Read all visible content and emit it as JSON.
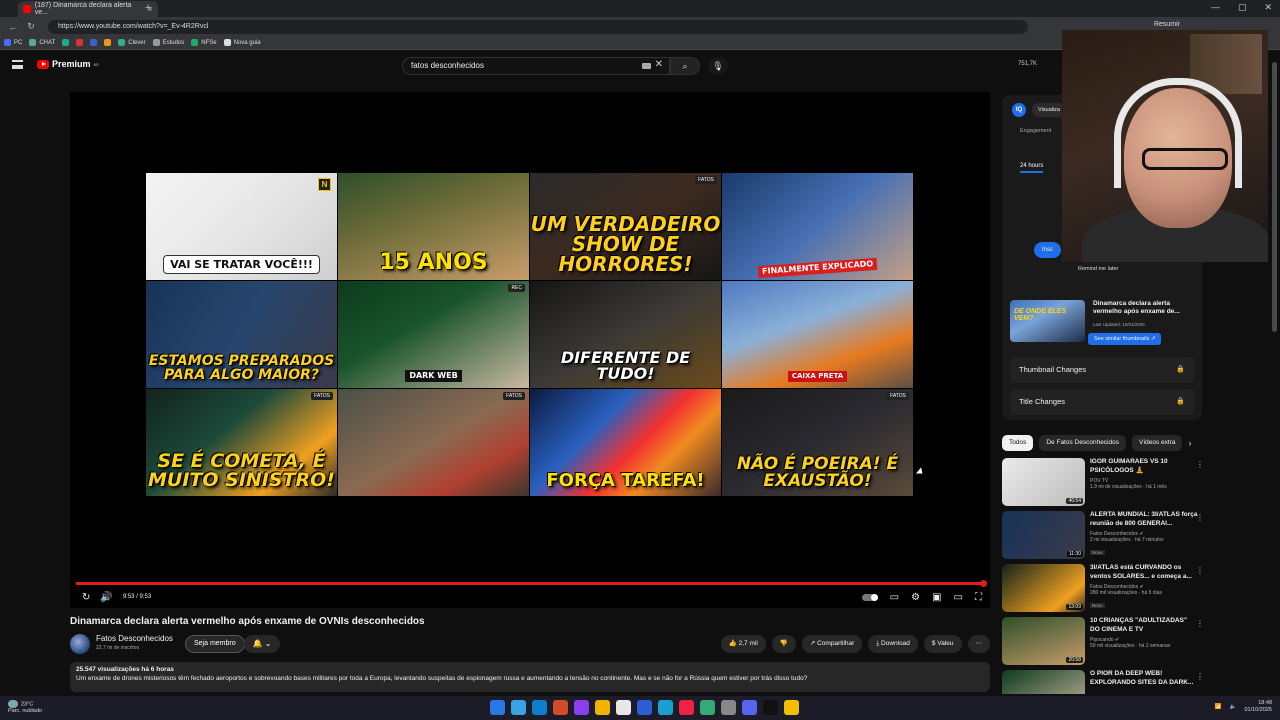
{
  "browser": {
    "tab_title": "(187) Dinamarca declara alerta ve...",
    "tab_close": "×",
    "new_tab": "+",
    "url": "https://www.youtube.com/watch?v=_Ev-4R2Rvcl",
    "resume_label": "Resumir",
    "window_controls": [
      "—",
      "▢",
      "✕"
    ],
    "bookmarks": [
      {
        "label": "PC",
        "color": "#4a6cf7"
      },
      {
        "label": "CHAT",
        "color": "#5a9"
      },
      {
        "label": "",
        "color": "#2a8"
      },
      {
        "label": "",
        "color": "#d33"
      },
      {
        "label": "",
        "color": "#36c"
      },
      {
        "label": "",
        "color": "#e91"
      },
      {
        "label": "Clever",
        "color": "#3a8"
      },
      {
        "label": "Estudos",
        "color": "#999"
      },
      {
        "label": "NFSe",
        "color": "#2a6"
      },
      {
        "label": "Nova guia",
        "color": "#ddd"
      }
    ]
  },
  "youtube": {
    "logo_text": "Premium",
    "logo_sup": "BR",
    "search_value": "fatos desconhecidos",
    "search_clear": "✕",
    "search_icon": "⌕",
    "mic_icon": "🎙",
    "stats_text": "751,7K",
    "colors": {
      "accent": "#e21c1c",
      "brand_blue": "#1f6feb"
    }
  },
  "player": {
    "thumbnails": [
      {
        "caption": "VAI SE TRATAR VOCÊ!!!",
        "badge": "N"
      },
      {
        "caption": "15 ANOS",
        "badge": ""
      },
      {
        "caption": "UM VERDADEIRO SHOW DE HORRORES!",
        "badge": "FATOS"
      },
      {
        "caption": "FINALMENTE EXPLICADO",
        "badge": ""
      },
      {
        "caption": "ESTAMOS PREPARADOS PARA ALGO MAIOR?",
        "badge": ""
      },
      {
        "caption": "DARK WEB",
        "badge": "REC"
      },
      {
        "caption": "DIFERENTE DE TUDO!",
        "badge": ""
      },
      {
        "caption": "CAIXA PRETA",
        "badge": ""
      },
      {
        "caption": "SE É COMETA, É MUITO SINISTRO!",
        "badge": "FATOS"
      },
      {
        "caption": "",
        "badge": "FATOS"
      },
      {
        "caption": "FORÇA TAREFA!",
        "badge": ""
      },
      {
        "caption": "NÃO É POEIRA! É EXAUSTÃO!",
        "badge": "FATOS"
      }
    ],
    "progress_fraction": 1.0,
    "time_display": "9:53 / 9:53",
    "replay_icon": "↻",
    "volume_icon": "🔊",
    "subtitles_icon": "▭",
    "settings_icon": "⚙",
    "miniplayer_icon": "▣",
    "theater_icon": "▭",
    "fullscreen_icon": "⛶"
  },
  "video": {
    "title": "Dinamarca declara alerta vermelho após enxame de OVNIs desconhecidos",
    "channel_name": "Fatos Desconhecidos",
    "subscribers": "22,7 mi de inscritos",
    "join_label": "Seja membro",
    "bell_label": "🔔 ⌄",
    "likes": "👍 2,7 mil",
    "dislike": "👎",
    "share": "↗ Compartilhar",
    "download": "⤓ Download",
    "thanks": "$ Valeu",
    "more": "⋯",
    "views_time": "25.547 visualizações  há 6 horas",
    "description": "Um enxame de drones misteriosos têm fechado aeroportos e sobrevoando bases militares por toda a Europa, levantando suspeitas de espionagem russa e aumentando a tensão no continente. Mas e se não for a Rússia quem estiver por trás disso tudo?"
  },
  "extension_panel": {
    "icon_text": "IQ",
    "visualize_label": "Visualiza",
    "engagement_label": "Engagement",
    "hours_tab": "24 hours",
    "subscribe_label": "Insc",
    "remind_label": "Remind me later",
    "thumb_text": "DE ONDE ELES VEM?",
    "thumb_title": "Dinamarca declara alerta vermelho após enxame de...",
    "thumb_date": "Last Updated: 10/01/2025",
    "similar_label": "See similar thumbnails ↗",
    "rows": [
      {
        "label": "Thumbnail Changes",
        "icon": "🔒"
      },
      {
        "label": "Title Changes",
        "icon": "🔒"
      }
    ]
  },
  "chips": [
    "Todos",
    "De Fatos Desconhecidos",
    "Vídeos extra"
  ],
  "chips_next": "›",
  "recommendations": [
    {
      "title": "IGOR GUIMARÃES VS 10 PSICÓLOGOS 🧘",
      "channel": "POV TV",
      "meta": "1,9 mi de visualizações · há 1 mês",
      "duration": "46:54",
      "new": ""
    },
    {
      "title": "ALERTA MUNDIAL: 3I/ATLAS força reunião de 800 GENERAI...",
      "channel": "Fatos Desconhecidos ✔",
      "meta": "2 mi visualizações · há 7 minutos",
      "duration": "11:30",
      "new": "Novo"
    },
    {
      "title": "3I/ATLAS está CURVANDO os ventos SOLARES... e começa a...",
      "channel": "Fatos Desconhecidos ✔",
      "meta": "280 mil visualizações · há 5 dias",
      "duration": "13:09",
      "new": "Novo"
    },
    {
      "title": "10 CRIANÇAS \"ADULTIZADAS\" DO CINEMA E TV",
      "channel": "Pipocando ✔",
      "meta": "59 mil visualizações · há 2 semanas",
      "duration": "20:58",
      "new": ""
    },
    {
      "title": "O PIOR DA DEEP WEB! EXPLORANDO SITES DA DARK...",
      "channel": "",
      "meta": "",
      "duration": "",
      "new": ""
    }
  ],
  "taskbar": {
    "temperature": "23°C",
    "weather": "Parc. nublado",
    "time": "18:48",
    "date": "01/10/2025",
    "app_colors": [
      "#2b78e4",
      "#3aa3e3",
      "#0f7ccc",
      "#d24c2a",
      "#8a3ef0",
      "#f0b400",
      "#e8e8e8",
      "#2d5fd4",
      "#1a9fd0",
      "#e24",
      "#3a7",
      "#888",
      "#5865f2",
      "#111",
      "#f0c000"
    ]
  }
}
